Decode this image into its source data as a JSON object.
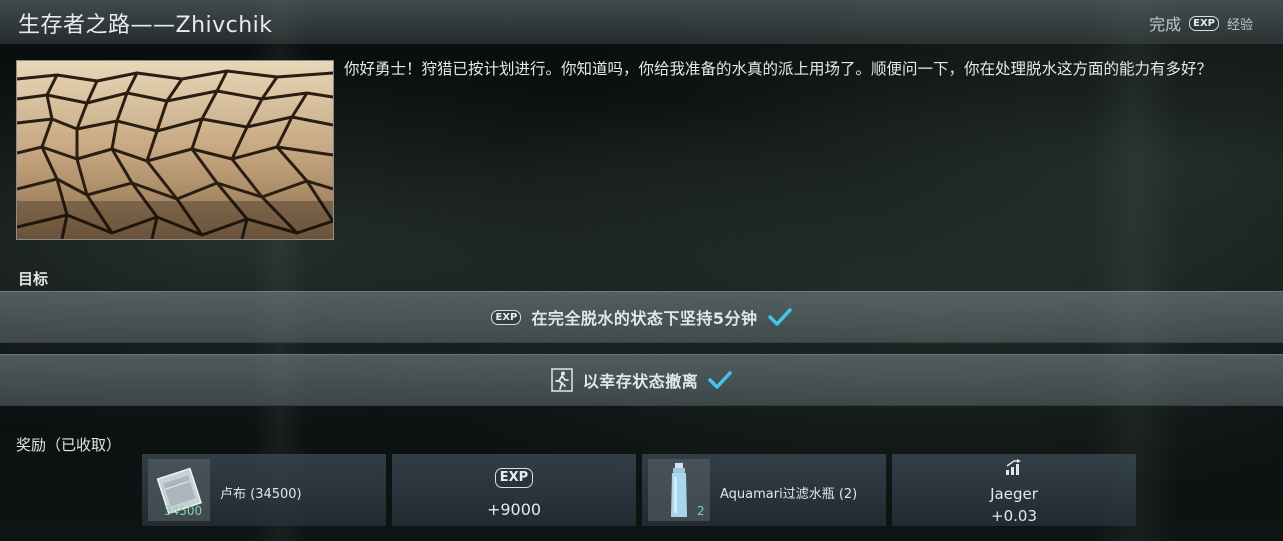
{
  "header": {
    "title": "生存者之路——Zhivchik",
    "status": "完成",
    "exp_badge": "EXP",
    "exp_label": "经验"
  },
  "quest": {
    "image_icon": "cracked-dry-earth-image",
    "description": "你好勇士！狩猎已按计划进行。你知道吗，你给我准备的水真的派上用场了。顺便问一下，你在处理脱水这方面的能力有多好？"
  },
  "objectives": {
    "label": "目标",
    "items": [
      {
        "icon": "exp-icon",
        "icon_text": "EXP",
        "text": "在完全脱水的状态下坚持5分钟",
        "completed": true
      },
      {
        "icon": "exit-run-icon",
        "text": "以幸存状态撤离",
        "completed": true
      }
    ]
  },
  "rewards": {
    "label": "奖励（已收取）",
    "items": [
      {
        "icon": "roubles-icon",
        "label": "卢布 (34500)",
        "count": "34500"
      },
      {
        "icon": "exp-icon",
        "icon_text": "EXP",
        "value": "+9000"
      },
      {
        "icon": "water-bottle-icon",
        "label": "Aquamari过滤水瓶 (2)",
        "count": "2"
      },
      {
        "icon": "standing-up-icon",
        "trader": "Jaeger",
        "value": "+0.03"
      }
    ]
  },
  "colors": {
    "check": "#45c3e8",
    "count": "#7fd3a6"
  }
}
